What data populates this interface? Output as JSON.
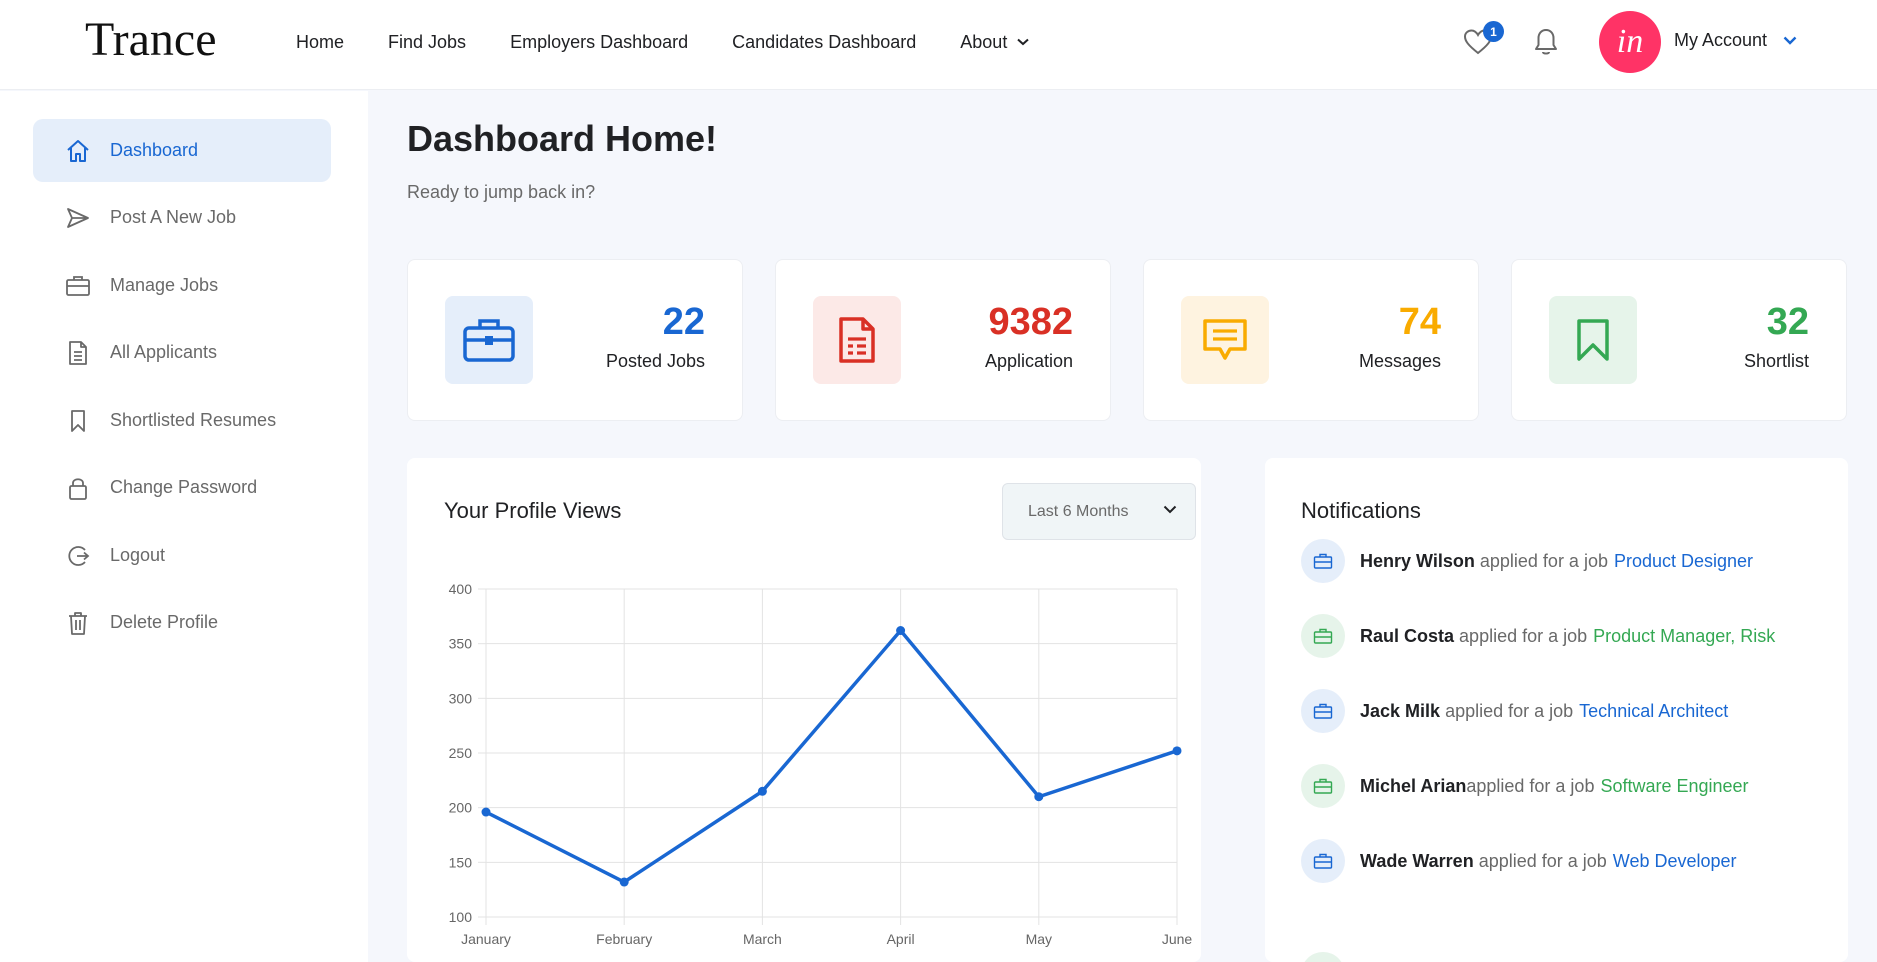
{
  "header": {
    "logo": "Trance",
    "nav": [
      {
        "label": "Home"
      },
      {
        "label": "Find Jobs"
      },
      {
        "label": "Employers Dashboard"
      },
      {
        "label": "Candidates Dashboard"
      },
      {
        "label": "About",
        "has_dropdown": true
      }
    ],
    "favorites_count": "1",
    "avatar_text": "in",
    "account_label": "My Account"
  },
  "sidebar": {
    "items": [
      {
        "label": "Dashboard",
        "icon": "home-icon",
        "active": true
      },
      {
        "label": "Post A New Job",
        "icon": "paper-plane-icon"
      },
      {
        "label": "Manage Jobs",
        "icon": "briefcase-icon"
      },
      {
        "label": "All Applicants",
        "icon": "document-icon"
      },
      {
        "label": "Shortlisted Resumes",
        "icon": "bookmark-icon"
      },
      {
        "label": "Change Password",
        "icon": "lock-icon"
      },
      {
        "label": "Logout",
        "icon": "logout-icon"
      },
      {
        "label": "Delete Profile",
        "icon": "trash-icon"
      }
    ]
  },
  "main": {
    "title": "Dashboard Home!",
    "subtitle": "Ready to jump back in?",
    "stats": [
      {
        "value": "22",
        "label": "Posted Jobs",
        "icon": "briefcase-icon",
        "color": "#1967d2",
        "bg": "#e5eefa"
      },
      {
        "value": "9382",
        "label": "Application",
        "icon": "document-icon",
        "color": "#d93025",
        "bg": "#fce9e7"
      },
      {
        "value": "74",
        "label": "Messages",
        "icon": "message-icon",
        "color": "#f9ab00",
        "bg": "#fef3e0"
      },
      {
        "value": "32",
        "label": "Shortlist",
        "icon": "bookmark-icon",
        "color": "#34a853",
        "bg": "#e6f4ea"
      }
    ],
    "profile_views": {
      "title": "Your Profile Views",
      "period_select": "Last 6 Months"
    },
    "notifications": {
      "title": "Notifications",
      "items": [
        {
          "name": "Henry Wilson",
          "sep": " ",
          "action": "applied for a job",
          "job": "Product Designer",
          "color": "#1967d2",
          "bg": "#e5eefa"
        },
        {
          "name": "Raul Costa",
          "sep": " ",
          "action": "applied for a job",
          "job": "Product Manager, Risk",
          "color": "#34a853",
          "bg": "#e6f4ea"
        },
        {
          "name": "Jack Milk",
          "sep": " ",
          "action": "applied for a job",
          "job": "Technical Architect",
          "color": "#1967d2",
          "bg": "#e5eefa"
        },
        {
          "name": "Michel Arian",
          "sep": "",
          "action": "applied for a job",
          "job": "Software Engineer",
          "color": "#34a853",
          "bg": "#e6f4ea"
        },
        {
          "name": "Wade Warren",
          "sep": " ",
          "action": "applied for a job",
          "job": "Web Developer",
          "color": "#1967d2",
          "bg": "#e5eefa"
        }
      ]
    }
  },
  "chart_data": {
    "type": "line",
    "categories": [
      "January",
      "February",
      "March",
      "April",
      "May",
      "June"
    ],
    "series": [
      {
        "values": [
          196,
          132,
          215,
          362,
          210,
          252
        ],
        "color": "#1967d2"
      }
    ],
    "ylim": [
      100,
      400
    ],
    "yticks": [
      "100",
      "150",
      "200",
      "250",
      "300",
      "350",
      "400"
    ],
    "grid": true
  }
}
